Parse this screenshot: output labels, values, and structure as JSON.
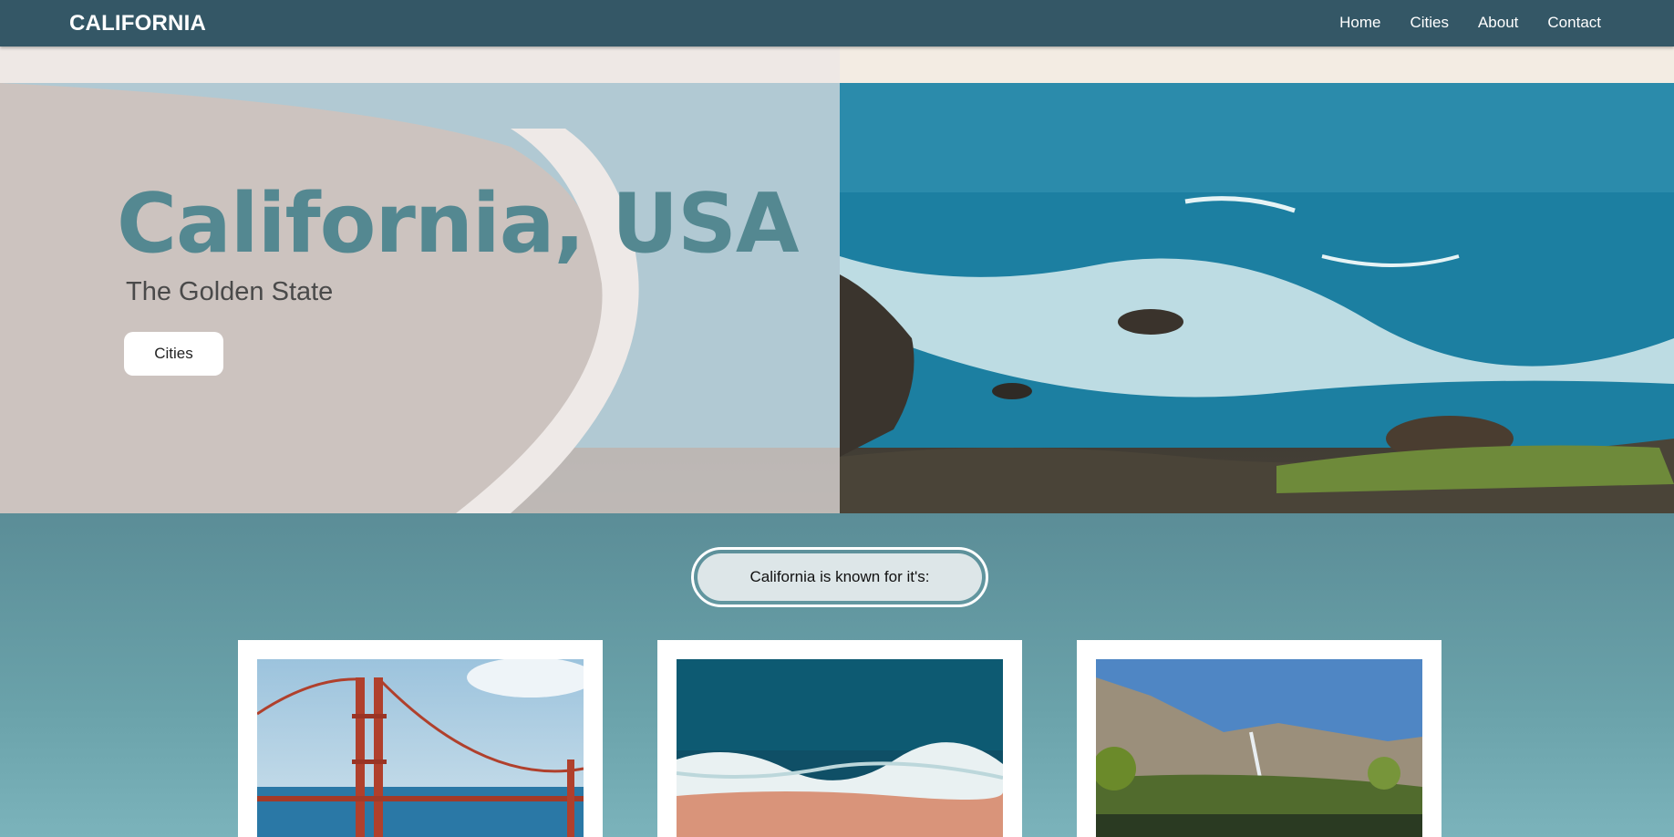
{
  "navbar": {
    "brand": "CALIFORNIA",
    "links": [
      {
        "label": "Home"
      },
      {
        "label": "Cities"
      },
      {
        "label": "About"
      },
      {
        "label": "Contact"
      }
    ]
  },
  "hero": {
    "title": "California, USA",
    "subtitle": "The Golden State",
    "button_label": "Cities"
  },
  "features": {
    "heading": "California is known for it's:"
  },
  "cards": [
    {
      "image": "golden-gate-bridge-photo"
    },
    {
      "image": "ocean-beach-aerial-photo"
    },
    {
      "image": "yosemite-valley-photo"
    }
  ],
  "colors": {
    "navbar": "#345766",
    "title": "#548891",
    "section_bg": "#5b8f98"
  }
}
